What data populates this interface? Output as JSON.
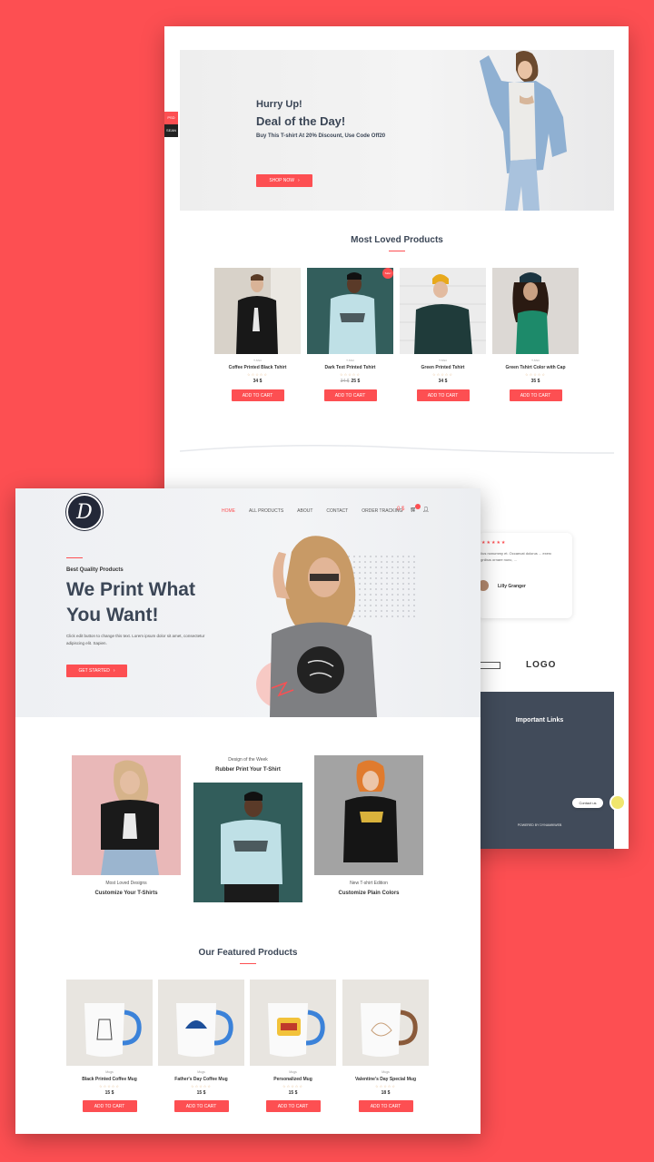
{
  "back": {
    "side_tabs": [
      "PSD",
      "SEAN"
    ],
    "deal": {
      "eyebrow": "Hurry Up!",
      "title": "Deal of the Day!",
      "subtitle": "Buy This T-shirt At 20% Discount, Use Code Off20",
      "button": "SHOP NOW"
    },
    "section_title": "Most Loved Products",
    "products": [
      {
        "category": "T-Shirt",
        "name": "Coffee Printed Black Tshirt",
        "stars": "☆☆☆☆☆",
        "old_price": "",
        "price": "34 $",
        "button": "ADD TO CART"
      },
      {
        "category": "T-Shirt",
        "name": "Dark Text Printed Tshirt",
        "stars": "☆☆☆☆☆",
        "old_price": "34 $",
        "price": "25 $",
        "button": "ADD TO CART",
        "badge": "Sale!"
      },
      {
        "category": "T-Shirt",
        "name": "Green Printed Tshirt",
        "stars": "☆☆☆☆☆",
        "old_price": "",
        "price": "34 $",
        "button": "ADD TO CART"
      },
      {
        "category": "T-Shirt",
        "name": "Green Tshirt Color with Cap",
        "stars": "☆☆☆☆☆",
        "old_price": "",
        "price": "35 $",
        "button": "ADD TO CART"
      }
    ],
    "review": {
      "stars": "★★★★★",
      "text": "...iius nonummy et. Occaecat dolorus ... exerc dignibus ornare nunc, ...",
      "name": "Lilly Granger"
    },
    "logos": [
      "LOGO"
    ],
    "footer": {
      "title": "Important Links",
      "powered": "POWERED BY DYNAMIKWEB"
    },
    "contact": "Contact us"
  },
  "front": {
    "logo_letter": "D",
    "nav": [
      "HOME",
      "ALL PRODUCTS",
      "ABOUT",
      "CONTACT",
      "ORDER TRACKING"
    ],
    "cart_total": "0 $",
    "hero": {
      "eyebrow": "Best Quality Products",
      "title": "We Print What You Want!",
      "description": "Click edit button to change this text. Lorem ipsum dolor sit amet, consectetur adipiscing elit. Sapien.",
      "button": "GET STARTED"
    },
    "tiles": [
      {
        "caption": "Most Loved Designs",
        "title": "Customize Your T-Shirts"
      },
      {
        "caption": "Design of the Week",
        "title": "Rubber Print Your T-Shirt"
      },
      {
        "caption": "New T-shirt Edition",
        "title": "Customize Plain Colors"
      }
    ],
    "section_title": "Our Featured Products",
    "products": [
      {
        "category": "Mugs",
        "name": "Black Printed Coffee Mug",
        "stars": "☆☆☆☆☆",
        "price": "15 $",
        "button": "ADD TO CART"
      },
      {
        "category": "Mugs",
        "name": "Father's Day Coffee Mug",
        "stars": "☆☆☆☆☆",
        "price": "15 $",
        "button": "ADD TO CART"
      },
      {
        "category": "Mugs",
        "name": "Personalized Mug",
        "stars": "☆☆☆☆☆",
        "price": "15 $",
        "button": "ADD TO CART"
      },
      {
        "category": "Mugs",
        "name": "Valentine's Day Special Mug",
        "stars": "☆☆☆☆☆",
        "price": "18 $",
        "button": "ADD TO CART"
      }
    ]
  },
  "colors": {
    "accent": "#fd4f52",
    "dark": "#3b4656",
    "footer": "#414b5a"
  }
}
